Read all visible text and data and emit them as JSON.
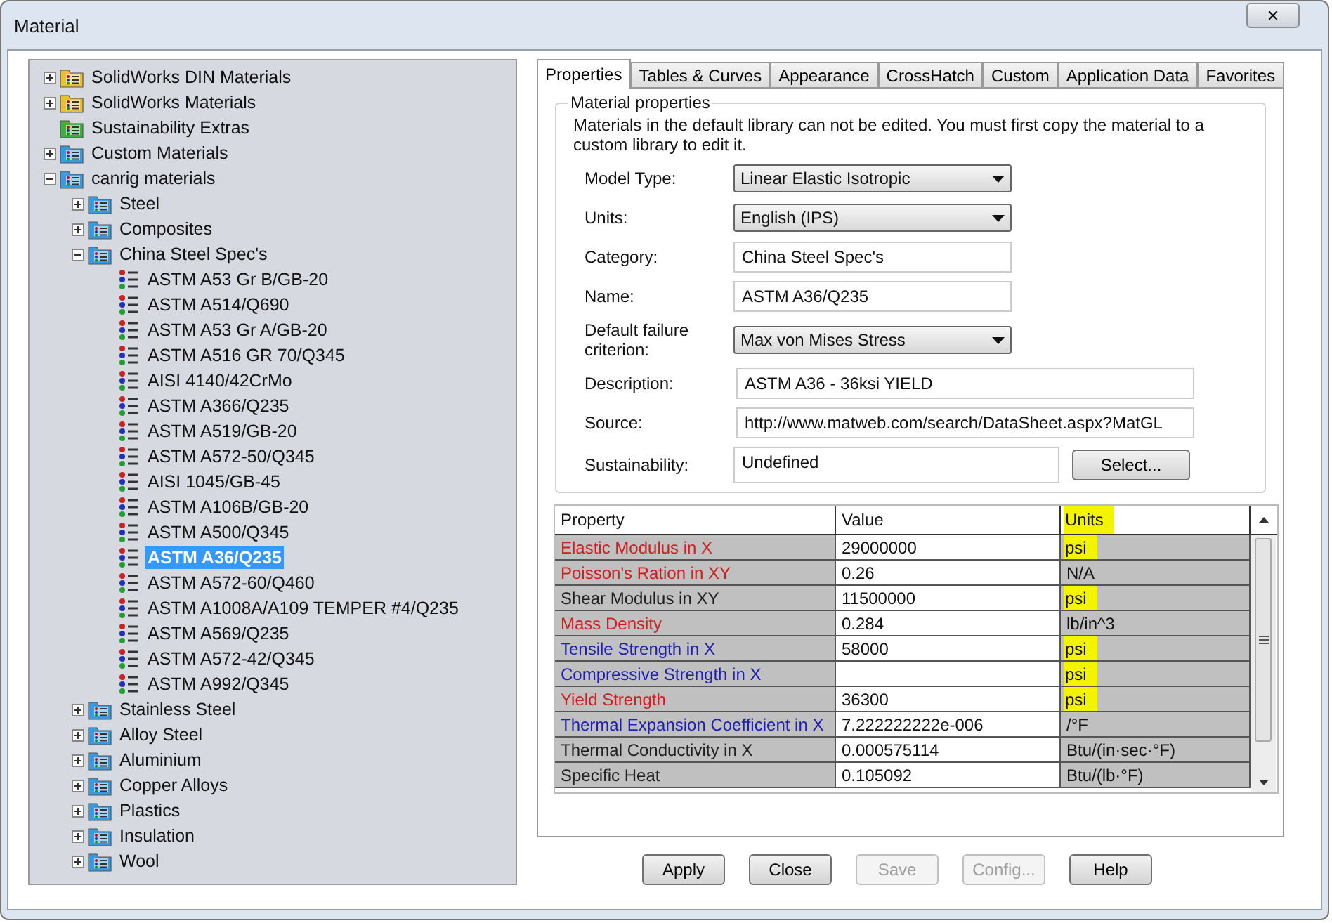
{
  "window": {
    "title": "Material",
    "close_label": "✕"
  },
  "tree": [
    {
      "label": "SolidWorks DIN Materials",
      "kind": "library",
      "color": "#e8c030",
      "expanded": false,
      "selected": false
    },
    {
      "label": "SolidWorks Materials",
      "kind": "library",
      "color": "#e8c030",
      "expanded": false,
      "selected": false
    },
    {
      "label": "Sustainability Extras",
      "kind": "library",
      "color": "#3cb040",
      "selected": false
    },
    {
      "label": "Custom Materials",
      "kind": "library",
      "color": "#3a9ae0",
      "expanded": false,
      "selected": false
    },
    {
      "label": "canrig materials",
      "kind": "library",
      "color": "#3a9ae0",
      "expanded": true,
      "selected": false,
      "children": [
        {
          "label": "Steel",
          "kind": "library",
          "color": "#3a9ae0",
          "expanded": false,
          "selected": false
        },
        {
          "label": "Composites",
          "kind": "library",
          "color": "#3a9ae0",
          "expanded": false,
          "selected": false
        },
        {
          "label": "China  Steel Spec's",
          "kind": "library",
          "color": "#3a9ae0",
          "expanded": true,
          "selected": false,
          "children": [
            {
              "label": "ASTM A53 Gr B/GB-20",
              "kind": "material",
              "selected": false
            },
            {
              "label": "ASTM A514/Q690",
              "kind": "material",
              "selected": false
            },
            {
              "label": "ASTM A53 Gr A/GB-20",
              "kind": "material",
              "selected": false
            },
            {
              "label": "ASTM A516 GR 70/Q345",
              "kind": "material",
              "selected": false
            },
            {
              "label": "AISI 4140/42CrMo",
              "kind": "material",
              "selected": false
            },
            {
              "label": "ASTM A366/Q235",
              "kind": "material",
              "selected": false
            },
            {
              "label": "ASTM A519/GB-20",
              "kind": "material",
              "selected": false
            },
            {
              "label": "ASTM A572-50/Q345",
              "kind": "material",
              "selected": false
            },
            {
              "label": "AISI 1045/GB-45",
              "kind": "material",
              "selected": false
            },
            {
              "label": "ASTM A106B/GB-20",
              "kind": "material",
              "selected": false
            },
            {
              "label": "ASTM A500/Q345",
              "kind": "material",
              "selected": false
            },
            {
              "label": "ASTM A36/Q235",
              "kind": "material",
              "selected": true
            },
            {
              "label": "ASTM A572-60/Q460",
              "kind": "material",
              "selected": false
            },
            {
              "label": "ASTM A1008A/A109 TEMPER #4/Q235",
              "kind": "material",
              "selected": false
            },
            {
              "label": "ASTM A569/Q235",
              "kind": "material",
              "selected": false
            },
            {
              "label": "ASTM A572-42/Q345",
              "kind": "material",
              "selected": false
            },
            {
              "label": "ASTM A992/Q345",
              "kind": "material",
              "selected": false
            }
          ]
        },
        {
          "label": "Stainless Steel",
          "kind": "library",
          "color": "#3a9ae0",
          "expanded": false,
          "selected": false
        },
        {
          "label": "Alloy Steel",
          "kind": "library",
          "color": "#3a9ae0",
          "expanded": false,
          "selected": false
        },
        {
          "label": "Aluminium",
          "kind": "library",
          "color": "#3a9ae0",
          "expanded": false,
          "selected": false
        },
        {
          "label": "Copper Alloys",
          "kind": "library",
          "color": "#3a9ae0",
          "expanded": false,
          "selected": false
        },
        {
          "label": "Plastics",
          "kind": "library",
          "color": "#3a9ae0",
          "expanded": false,
          "selected": false
        },
        {
          "label": "Insulation",
          "kind": "library",
          "color": "#3a9ae0",
          "expanded": false,
          "selected": false
        },
        {
          "label": "Wool",
          "kind": "library",
          "color": "#3a9ae0",
          "expanded": false,
          "selected": false
        }
      ]
    }
  ],
  "tabs": [
    {
      "label": "Properties",
      "selected": true
    },
    {
      "label": "Tables & Curves",
      "selected": false
    },
    {
      "label": "Appearance",
      "selected": false
    },
    {
      "label": "CrossHatch",
      "selected": false
    },
    {
      "label": "Custom",
      "selected": false
    },
    {
      "label": "Application Data",
      "selected": false
    },
    {
      "label": "Favorites",
      "selected": false
    }
  ],
  "material_properties": {
    "title": "Material properties",
    "note": "Materials in the default library can not be edited. You must first copy the material to a custom library to edit it.",
    "fields": [
      {
        "label": "Model Type:",
        "kind": "dropdown",
        "value": "Linear Elastic Isotropic"
      },
      {
        "label": "Units:",
        "kind": "dropdown",
        "value": "English (IPS)"
      },
      {
        "label": "Category:",
        "kind": "text",
        "value": "China  Steel Spec's"
      },
      {
        "label": "Name:",
        "kind": "text",
        "value": "ASTM A36/Q235"
      },
      {
        "label": "Default failure criterion:",
        "kind": "dropdown",
        "value": "Max von Mises Stress"
      },
      {
        "label": "Description:",
        "kind": "wide",
        "value": "ASTM A36 - 36ksi YIELD"
      },
      {
        "label": "Source:",
        "kind": "wide",
        "value": "http://www.matweb.com/search/DataSheet.aspx?MatGL"
      },
      {
        "label": "Sustainability:",
        "kind": "select",
        "value": "Undefined",
        "button": "Select..."
      }
    ]
  },
  "table": {
    "columns": [
      {
        "label": "Property",
        "highlighted": false
      },
      {
        "label": "Value",
        "highlighted": false
      },
      {
        "label": "Units",
        "highlighted": true
      }
    ],
    "rows": [
      {
        "property": "Elastic Modulus in X",
        "color": "#cc2020",
        "value": "29000000",
        "units": "psi",
        "highlighted": true
      },
      {
        "property": "Poisson's Ration in XY",
        "color": "#cc2020",
        "value": "0.26",
        "units": "N/A",
        "highlighted": false
      },
      {
        "property": "Shear Modulus in XY",
        "color": "#202020",
        "value": "11500000",
        "units": "psi",
        "highlighted": true
      },
      {
        "property": "Mass Density",
        "color": "#cc2020",
        "value": "0.284",
        "units": "lb/in^3",
        "highlighted": false
      },
      {
        "property": "Tensile Strength in X",
        "color": "#2020b0",
        "value": "58000",
        "units": "psi",
        "highlighted": true
      },
      {
        "property": "Compressive Strength in X",
        "color": "#2020b0",
        "units": "psi",
        "highlighted": true
      },
      {
        "property": "Yield Strength",
        "color": "#cc2020",
        "value": "36300",
        "units": "psi",
        "highlighted": true
      },
      {
        "property": "Thermal Expansion Coefficient in X",
        "color": "#2020b0",
        "value": "7.222222222e-006",
        "units": "/°F",
        "highlighted": false
      },
      {
        "property": "Thermal Conductivity in X",
        "color": "#202020",
        "value": "0.000575114",
        "units": "Btu/(in·sec·°F)",
        "highlighted": false
      },
      {
        "property": "Specific Heat",
        "color": "#202020",
        "value": "0.105092",
        "units": "Btu/(lb·°F)",
        "highlighted": false
      }
    ]
  },
  "buttons": [
    {
      "label": "Apply",
      "disabled": false
    },
    {
      "label": "Close",
      "disabled": false
    },
    {
      "label": "Save",
      "disabled": true
    },
    {
      "label": "Config...",
      "disabled": true
    },
    {
      "label": "Help",
      "disabled": false
    }
  ]
}
